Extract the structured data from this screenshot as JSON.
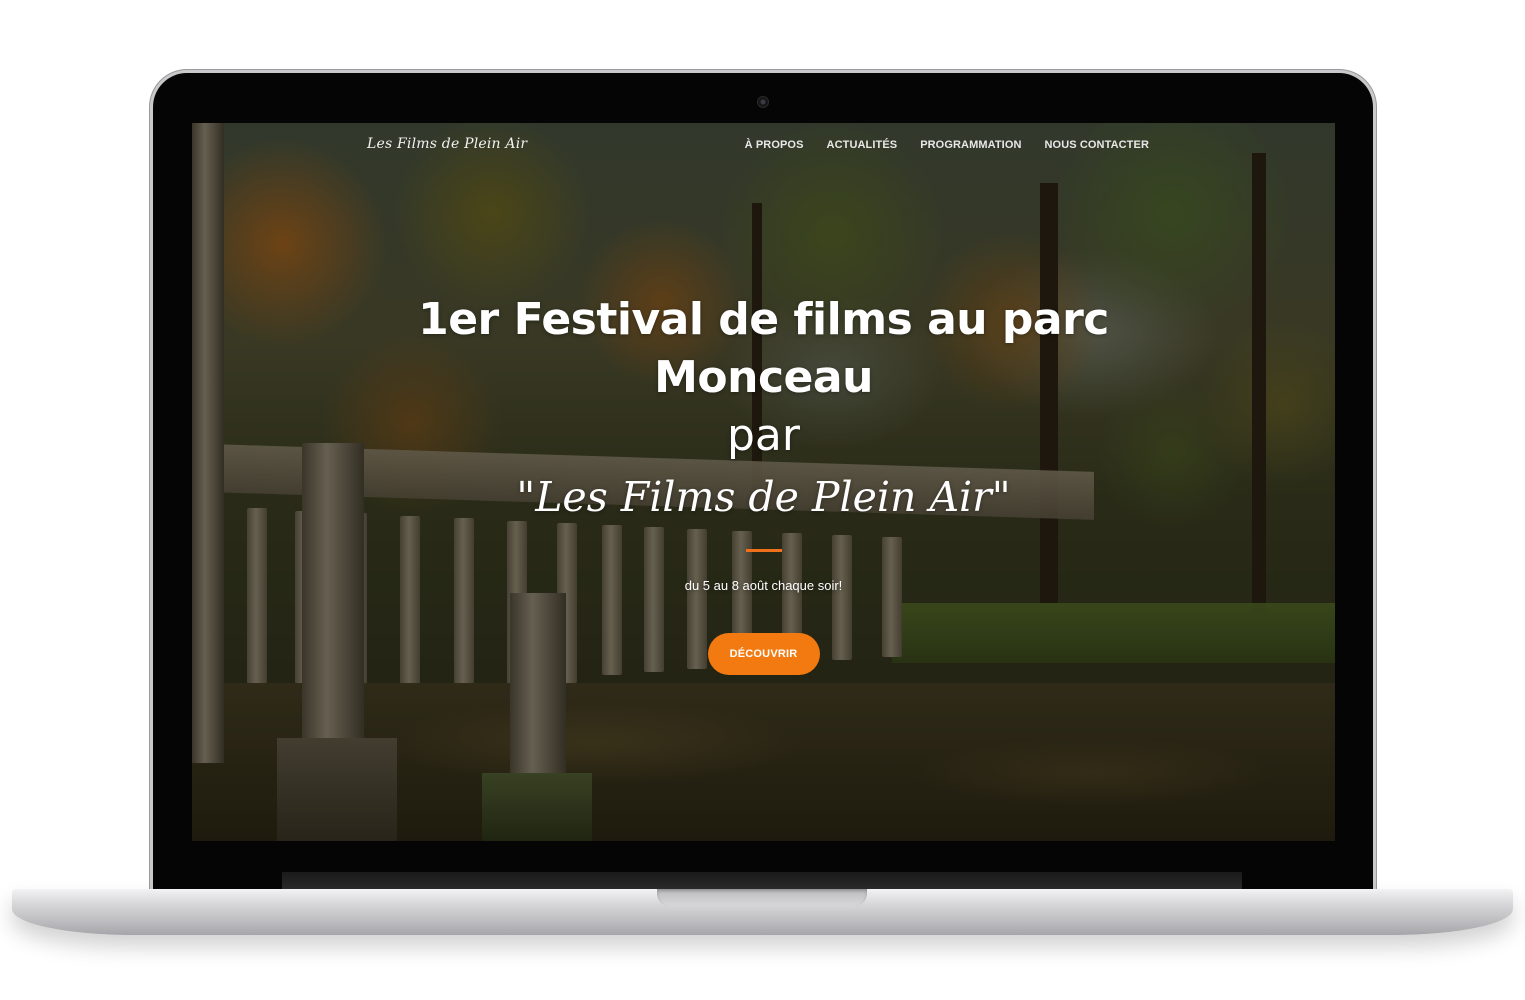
{
  "site": {
    "brand": "Les Films de Plein Air",
    "nav": {
      "items": [
        "À PROPOS",
        "ACTUALITÉS",
        "PROGRAMMATION",
        "NOUS CONTACTER"
      ]
    }
  },
  "hero": {
    "title_line1": "1er Festival de films au parc",
    "title_line2": "Monceau",
    "by": "par",
    "name": "\"Les Films de Plein Air\"",
    "subtitle": "du 5 au 8 août chaque soir!",
    "cta_label": "DÉCOUVRIR"
  },
  "colors": {
    "accent": "#f27a10",
    "text": "#ffffff"
  }
}
